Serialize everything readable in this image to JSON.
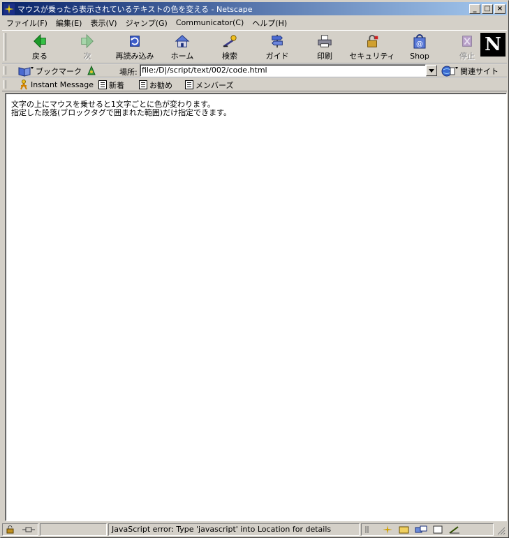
{
  "window": {
    "title": "マウスが乗ったら表示されているテキストの色を変える - Netscape",
    "controls": {
      "minimize": "_",
      "maximize": "□",
      "close": "×"
    }
  },
  "menu": {
    "items": [
      "ファイル(F)",
      "編集(E)",
      "表示(V)",
      "ジャンプ(G)",
      "Communicator(C)",
      "ヘルプ(H)"
    ]
  },
  "nav_toolbar": {
    "buttons": [
      {
        "label": "戻る",
        "icon": "back-arrow-icon",
        "enabled": true
      },
      {
        "label": "次",
        "icon": "forward-arrow-icon",
        "enabled": false
      },
      {
        "label": "再読み込み",
        "icon": "reload-icon",
        "enabled": true
      },
      {
        "label": "ホーム",
        "icon": "home-icon",
        "enabled": true
      },
      {
        "label": "検索",
        "icon": "search-icon",
        "enabled": true
      },
      {
        "label": "ガイド",
        "icon": "guide-icon",
        "enabled": true
      },
      {
        "label": "印刷",
        "icon": "print-icon",
        "enabled": true
      },
      {
        "label": "セキュリティ",
        "icon": "lock-icon",
        "enabled": true
      },
      {
        "label": "Shop",
        "icon": "shop-icon",
        "enabled": true
      },
      {
        "label": "停止",
        "icon": "stop-icon",
        "enabled": false
      }
    ],
    "logo_letter": "N"
  },
  "location_toolbar": {
    "bookmarks_label": "ブックマーク",
    "location_label": "場所:",
    "url": "file:/D|/script/text/002/code.html",
    "related_label": "関連サイト"
  },
  "personal_toolbar": {
    "items": [
      {
        "label": "Instant Message",
        "icon": "instant-message-icon"
      },
      {
        "label": "新着",
        "icon": "page-icon"
      },
      {
        "label": "お勧め",
        "icon": "page-icon"
      },
      {
        "label": "メンバーズ",
        "icon": "page-icon"
      }
    ]
  },
  "content": {
    "lines": [
      "文字の上にマウスを乗せると1文字ごとに色が変わります。",
      "指定した段落(ブロックタグで囲まれた範囲)だけ指定できます。"
    ]
  },
  "status": {
    "message": "JavaScript error: Type 'javascript' into Location for details"
  },
  "colors": {
    "titlebar_start": "#0a246a",
    "titlebar_end": "#a6caf0",
    "chrome": "#d4d0c8"
  }
}
